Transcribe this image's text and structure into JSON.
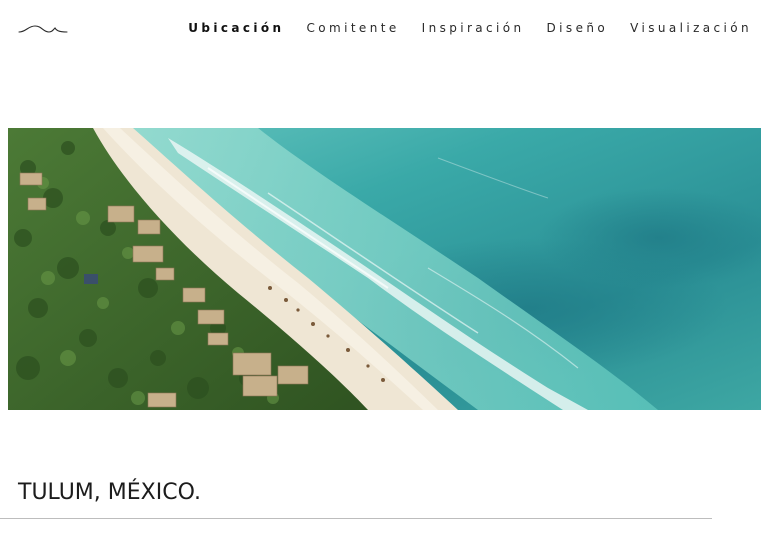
{
  "logo": {
    "icon": "wave-logo-icon"
  },
  "nav": {
    "items": [
      {
        "label": "Ubicación",
        "active": true
      },
      {
        "label": "Comitente",
        "active": false
      },
      {
        "label": "Inspiración",
        "active": false
      },
      {
        "label": "Diseño",
        "active": false
      },
      {
        "label": "Visualización",
        "active": false
      }
    ]
  },
  "hero": {
    "icon": "aerial-beach-photo",
    "colors": {
      "sea_deep": "#2f9ea0",
      "sea_shallow": "#5cc6bd",
      "sand": "#efe6d4",
      "jungle": "#3f6b2c"
    }
  },
  "section": {
    "title": "TULUM, MÉXICO."
  },
  "colors": {
    "text": "#1c1c1c",
    "divider": "#bdbdbd",
    "background": "#ffffff"
  }
}
